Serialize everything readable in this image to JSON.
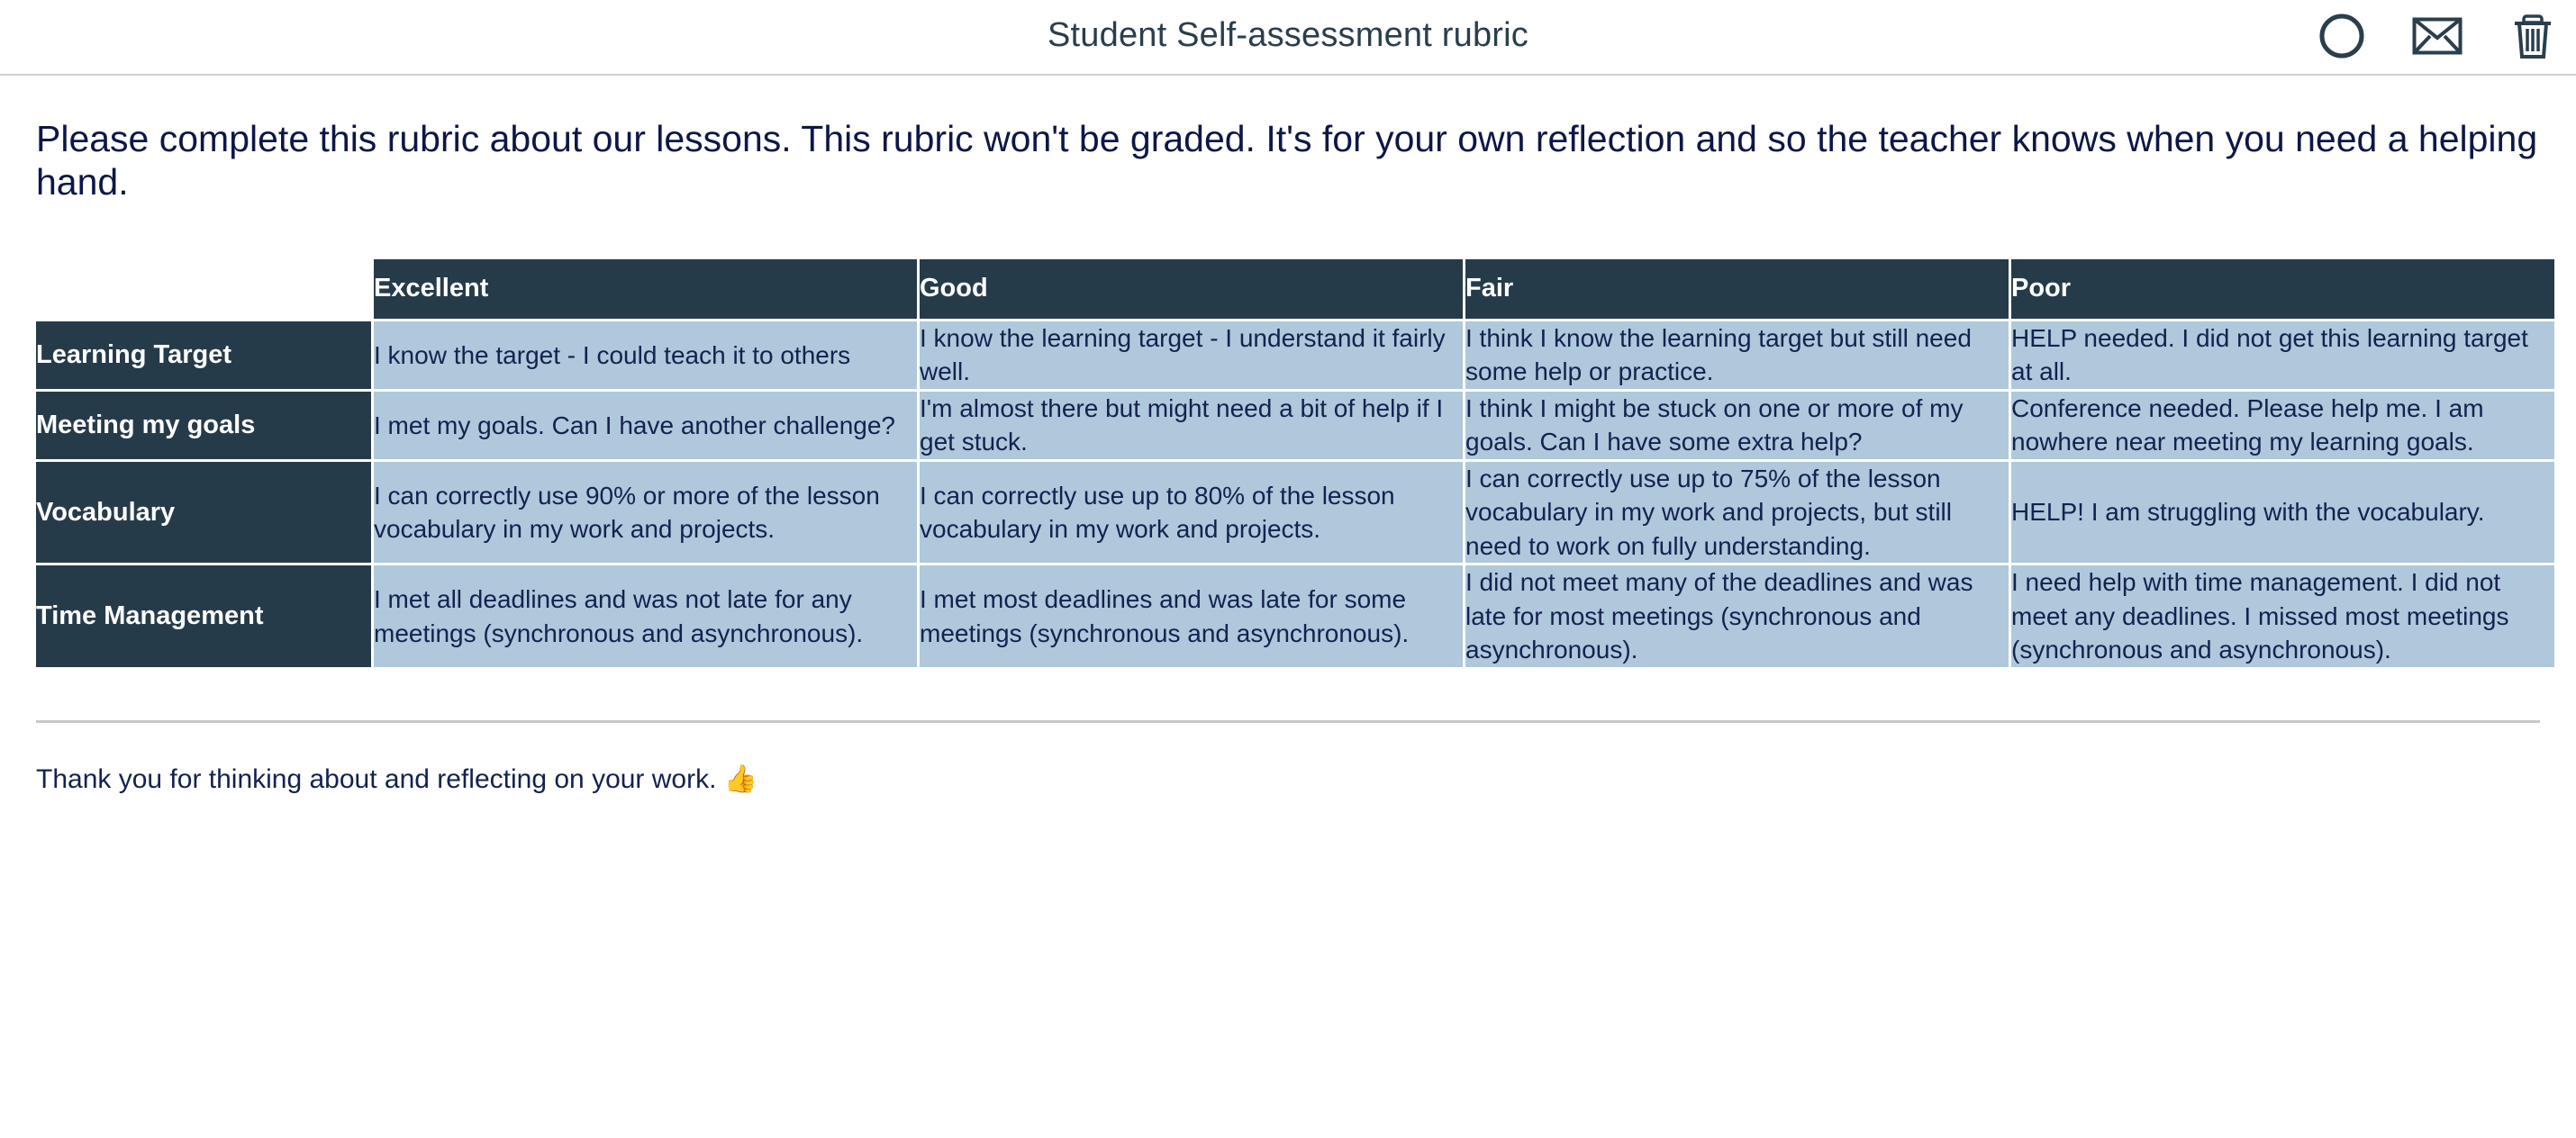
{
  "appbar": {
    "title": "Student Self-assessment rubric",
    "actions": [
      {
        "name": "profile-circle-icon",
        "label": "Profile"
      },
      {
        "name": "mail-icon",
        "label": "Mail"
      },
      {
        "name": "trash-icon",
        "label": "Delete"
      }
    ]
  },
  "intro": "Please complete this rubric about our lessons. This rubric won't be graded. It's for your own reflection and so the teacher knows when you need a helping hand.",
  "rubric": {
    "corner_label": "",
    "columns": [
      "Excellent",
      "Good",
      "Fair",
      "Poor"
    ],
    "rows": [
      {
        "criterion": "Learning Target",
        "cells": [
          "I know the target - I could teach it to others",
          "I know the learning target - I understand it fairly well.",
          "I think I know the learning target but still need some help or practice.",
          "HELP needed. I did not get this learning target at all."
        ]
      },
      {
        "criterion": "Meeting my goals",
        "cells": [
          "I met my goals. Can I have another challenge?",
          "I'm almost there but might need a bit of help if I get stuck.",
          "I think I might be stuck on one or more of my goals. Can I have some extra help?",
          "Conference needed. Please help me. I am nowhere near meeting my learning goals."
        ]
      },
      {
        "criterion": "Vocabulary",
        "cells": [
          "I can correctly use 90% or more of the lesson vocabulary in my work and projects.",
          "I can correctly use up to 80% of the lesson vocabulary in my work and projects.",
          "I can correctly use up to 75% of the lesson vocabulary in my work and projects, but still need to work on fully understanding.",
          "HELP! I am struggling with the vocabulary."
        ]
      },
      {
        "criterion": "Time Management",
        "cells": [
          "I met all deadlines and was not late for any meetings (synchronous and asynchronous).",
          "I met most deadlines and was late for some meetings (synchronous and asynchronous).",
          "I did not meet many of the deadlines and was late for most meetings (synchronous and asynchronous).",
          "I need help with time management. I did not meet any deadlines. I missed most meetings (synchronous and asynchronous)."
        ]
      }
    ]
  },
  "footer": {
    "text": "Thank you for thinking about and reflecting on your work.",
    "emoji": "👍"
  },
  "colors": {
    "header_navy": "#263b4a",
    "cell_blue": "#afc8db",
    "text_navy": "#13224f",
    "title_navy": "#2a3e4c",
    "rule_gray": "#c9c9c9"
  }
}
